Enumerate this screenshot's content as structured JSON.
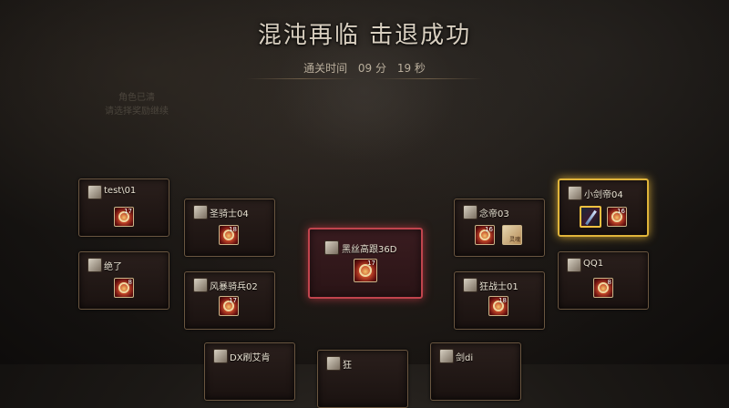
{
  "header": {
    "title": "混沌再临 击退成功",
    "clear_time_label": "通关时间",
    "minutes": "09 分",
    "seconds": "19 秒"
  },
  "background_note": [
    "角色已清",
    "请选择奖励继续"
  ],
  "players": [
    {
      "name": "test\\01",
      "reward_count": "17"
    },
    {
      "name": "绝了",
      "reward_count": "8"
    },
    {
      "name": "圣骑士04",
      "reward_count": "18"
    },
    {
      "name": "风暴骑兵02",
      "reward_count": "17"
    },
    {
      "name": "黑丝高跟36D",
      "reward_count": "17"
    },
    {
      "name": "念帝03",
      "reward_count": "16",
      "extra_item_label": "灵魂"
    },
    {
      "name": "狂战士01",
      "reward_count": "18"
    },
    {
      "name": "小剑帝04",
      "reward_count": "16",
      "highlighted": true
    },
    {
      "name": "QQ1",
      "reward_count": "8"
    },
    {
      "name": "DX刷艾肯"
    },
    {
      "name": "狂"
    },
    {
      "name": "剑di"
    }
  ],
  "colors": {
    "title": "#d8cfc0",
    "highlight_gold": "#e0b43a",
    "center_red": "#c0444d"
  }
}
